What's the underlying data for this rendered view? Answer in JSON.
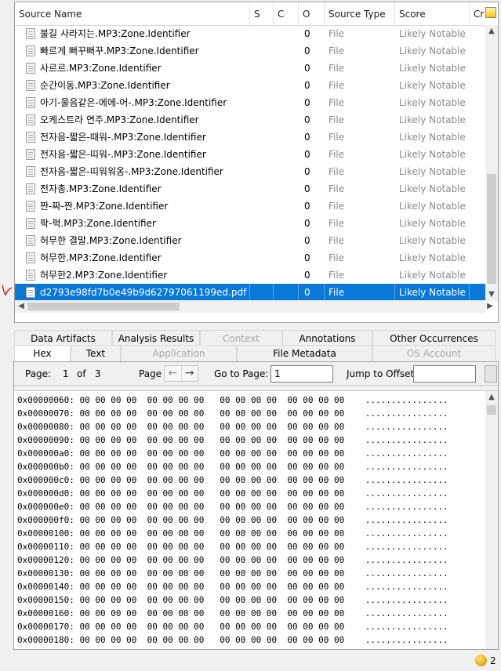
{
  "table": {
    "columns": [
      "Source Name",
      "S",
      "C",
      "O",
      "Source Type",
      "Score",
      "Cr"
    ],
    "rows": [
      {
        "name": "불길 사라지는.MP3:Zone.Identifier",
        "s": "",
        "c": "",
        "o": "0",
        "type": "File",
        "score": "Likely Notable"
      },
      {
        "name": "빠르게 뻐꾸뻐꾸.MP3:Zone.Identifier",
        "s": "",
        "c": "",
        "o": "0",
        "type": "File",
        "score": "Likely Notable"
      },
      {
        "name": "사르르.MP3:Zone.Identifier",
        "s": "",
        "c": "",
        "o": "0",
        "type": "File",
        "score": "Likely Notable"
      },
      {
        "name": "순간이동.MP3:Zone.Identifier",
        "s": "",
        "c": "",
        "o": "0",
        "type": "File",
        "score": "Likely Notable"
      },
      {
        "name": "아기-울음같은-에에-어-.MP3:Zone.Identifier",
        "s": "",
        "c": "",
        "o": "0",
        "type": "File",
        "score": "Likely Notable"
      },
      {
        "name": "오케스트라 연주.MP3:Zone.Identifier",
        "s": "",
        "c": "",
        "o": "0",
        "type": "File",
        "score": "Likely Notable"
      },
      {
        "name": "전자음-짧은-때워-.MP3:Zone.Identifier",
        "s": "",
        "c": "",
        "o": "0",
        "type": "File",
        "score": "Likely Notable"
      },
      {
        "name": "전자음-짧은-띠워-.MP3:Zone.Identifier",
        "s": "",
        "c": "",
        "o": "0",
        "type": "File",
        "score": "Likely Notable"
      },
      {
        "name": "전자음-짧은-띠워워옹-.MP3:Zone.Identifier",
        "s": "",
        "c": "",
        "o": "0",
        "type": "File",
        "score": "Likely Notable"
      },
      {
        "name": "전자총.MP3:Zone.Identifier",
        "s": "",
        "c": "",
        "o": "0",
        "type": "File",
        "score": "Likely Notable"
      },
      {
        "name": "짠-짜-짠.MP3:Zone.Identifier",
        "s": "",
        "c": "",
        "o": "0",
        "type": "File",
        "score": "Likely Notable"
      },
      {
        "name": "팍-퍽.MP3:Zone.Identifier",
        "s": "",
        "c": "",
        "o": "0",
        "type": "File",
        "score": "Likely Notable"
      },
      {
        "name": "허무한 결말.MP3:Zone.Identifier",
        "s": "",
        "c": "",
        "o": "0",
        "type": "File",
        "score": "Likely Notable"
      },
      {
        "name": "허무한.MP3:Zone.Identifier",
        "s": "",
        "c": "",
        "o": "0",
        "type": "File",
        "score": "Likely Notable"
      },
      {
        "name": "허무한2.MP3:Zone.Identifier",
        "s": "",
        "c": "",
        "o": "0",
        "type": "File",
        "score": "Likely Notable"
      },
      {
        "name": "d2793e98fd7b0e49b9d62797061199ed.pdf",
        "s": "",
        "c": "",
        "o": "0",
        "type": "File",
        "score": "Likely Notable",
        "selected": true
      }
    ]
  },
  "tabs_row1": [
    {
      "label": "Data Artifacts",
      "disabled": false
    },
    {
      "label": "Analysis Results",
      "disabled": false
    },
    {
      "label": "Context",
      "disabled": true
    },
    {
      "label": "Annotations",
      "disabled": false
    },
    {
      "label": "Other Occurrences",
      "disabled": false
    }
  ],
  "tabs_row2": [
    {
      "label": "Hex",
      "disabled": false,
      "active": true
    },
    {
      "label": "Text",
      "disabled": false
    },
    {
      "label": "Application",
      "disabled": true
    },
    {
      "label": "File Metadata",
      "disabled": false
    },
    {
      "label": "OS Account",
      "disabled": true
    }
  ],
  "hex_toolbar": {
    "page_label": "Page:",
    "page_current": "1",
    "of_label": "of",
    "page_total": "3",
    "page_nav_label": "Page",
    "goto_label": "Go to Page:",
    "goto_value": "1",
    "jump_label": "Jump to Offset",
    "jump_value": ""
  },
  "hex_lines": [
    {
      "offset": "0x00000060:",
      "bytes": "00 00 00 00  00 00 00 00   00 00 00 00  00 00 00 00",
      "ascii": "................"
    },
    {
      "offset": "0x00000070:",
      "bytes": "00 00 00 00  00 00 00 00   00 00 00 00  00 00 00 00",
      "ascii": "................"
    },
    {
      "offset": "0x00000080:",
      "bytes": "00 00 00 00  00 00 00 00   00 00 00 00  00 00 00 00",
      "ascii": "................"
    },
    {
      "offset": "0x00000090:",
      "bytes": "00 00 00 00  00 00 00 00   00 00 00 00  00 00 00 00",
      "ascii": "................"
    },
    {
      "offset": "0x000000a0:",
      "bytes": "00 00 00 00  00 00 00 00   00 00 00 00  00 00 00 00",
      "ascii": "................"
    },
    {
      "offset": "0x000000b0:",
      "bytes": "00 00 00 00  00 00 00 00   00 00 00 00  00 00 00 00",
      "ascii": "................"
    },
    {
      "offset": "0x000000c0:",
      "bytes": "00 00 00 00  00 00 00 00   00 00 00 00  00 00 00 00",
      "ascii": "................"
    },
    {
      "offset": "0x000000d0:",
      "bytes": "00 00 00 00  00 00 00 00   00 00 00 00  00 00 00 00",
      "ascii": "................"
    },
    {
      "offset": "0x000000e0:",
      "bytes": "00 00 00 00  00 00 00 00   00 00 00 00  00 00 00 00",
      "ascii": "................"
    },
    {
      "offset": "0x000000f0:",
      "bytes": "00 00 00 00  00 00 00 00   00 00 00 00  00 00 00 00",
      "ascii": "................"
    },
    {
      "offset": "0x00000100:",
      "bytes": "00 00 00 00  00 00 00 00   00 00 00 00  00 00 00 00",
      "ascii": "................"
    },
    {
      "offset": "0x00000110:",
      "bytes": "00 00 00 00  00 00 00 00   00 00 00 00  00 00 00 00",
      "ascii": "................"
    },
    {
      "offset": "0x00000120:",
      "bytes": "00 00 00 00  00 00 00 00   00 00 00 00  00 00 00 00",
      "ascii": "................"
    },
    {
      "offset": "0x00000130:",
      "bytes": "00 00 00 00  00 00 00 00   00 00 00 00  00 00 00 00",
      "ascii": "................"
    },
    {
      "offset": "0x00000140:",
      "bytes": "00 00 00 00  00 00 00 00   00 00 00 00  00 00 00 00",
      "ascii": "................"
    },
    {
      "offset": "0x00000150:",
      "bytes": "00 00 00 00  00 00 00 00   00 00 00 00  00 00 00 00",
      "ascii": "................"
    },
    {
      "offset": "0x00000160:",
      "bytes": "00 00 00 00  00 00 00 00   00 00 00 00  00 00 00 00",
      "ascii": "................"
    },
    {
      "offset": "0x00000170:",
      "bytes": "00 00 00 00  00 00 00 00   00 00 00 00  00 00 00 00",
      "ascii": "................"
    },
    {
      "offset": "0x00000180:",
      "bytes": "00 00 00 00  00 00 00 00   00 00 00 00  00 00 00 00",
      "ascii": "................"
    }
  ],
  "status": {
    "notification_count": "2"
  },
  "colors": {
    "selection": "#0a78d7",
    "muted_text": "#8a8a8a"
  },
  "icons": {
    "row_icon": "file-icon",
    "notification": "notification-bulb-icon",
    "corner": "column-chooser-icon"
  }
}
